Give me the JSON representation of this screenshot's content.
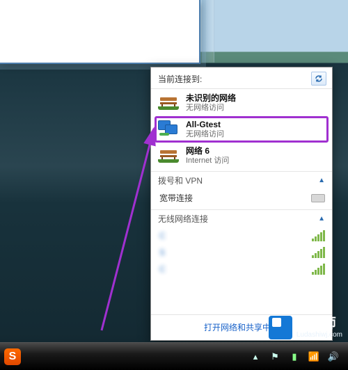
{
  "flyout": {
    "header_title": "当前连接到:",
    "networks": [
      {
        "name": "未识别的网络",
        "status": "无网络访问"
      },
      {
        "name": "All-Gtest",
        "status": "无网络访问"
      },
      {
        "name": "网络  6",
        "status": "Internet 访问"
      }
    ],
    "section_dial": "拨号和 VPN",
    "broadband_label": "宽带连接",
    "section_wifi": "无线网络连接",
    "wifi": [
      {
        "ssid": "C"
      },
      {
        "ssid": "S"
      },
      {
        "ssid": "C"
      }
    ],
    "footer_link": "打开网络和共享中心"
  },
  "taskbar": {
    "ime_label": "S"
  },
  "watermark": {
    "brand": "鹿大师",
    "url": "Ludashiwj.com"
  }
}
